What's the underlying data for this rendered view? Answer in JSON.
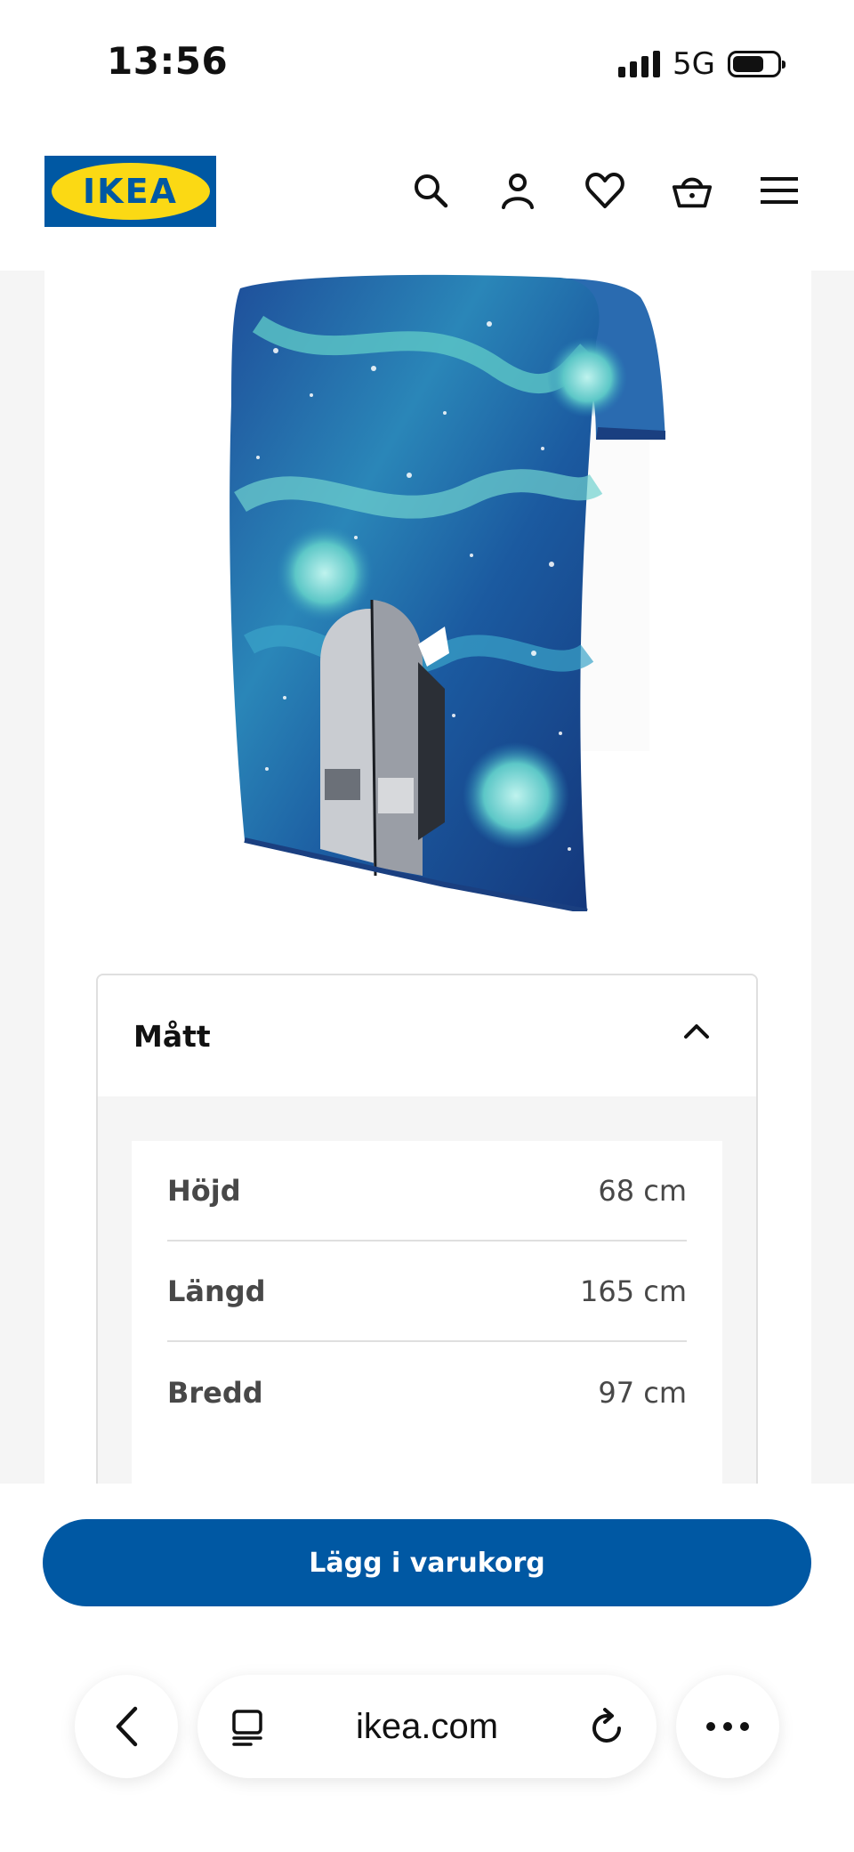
{
  "status": {
    "time": "13:56",
    "network": "5G"
  },
  "header": {
    "logo_text": "IKEA"
  },
  "nav": {
    "icons": [
      "search-icon",
      "account-icon",
      "heart-icon",
      "basket-icon",
      "menu-icon"
    ]
  },
  "dimensions": {
    "title": "Mått",
    "rows": [
      {
        "label": "Höjd",
        "value": "68 cm"
      },
      {
        "label": "Längd",
        "value": "165 cm"
      },
      {
        "label": "Bredd",
        "value": "97 cm"
      }
    ]
  },
  "cta": {
    "add_to_cart": "Lägg i varukorg"
  },
  "browser": {
    "url": "ikea.com"
  },
  "colors": {
    "ikea_blue": "#0058a3",
    "ikea_yellow": "#fbd914"
  }
}
